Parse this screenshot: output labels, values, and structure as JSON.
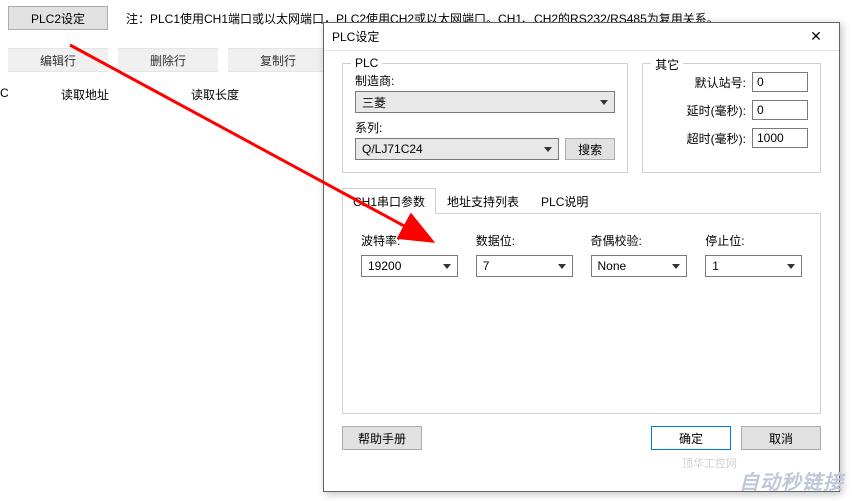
{
  "top": {
    "plc2_btn": "PLC2设定",
    "note": "注：PLC1使用CH1端口或以太网端口，PLC2使用CH2或以太网端口。CH1、CH2的RS232/RS485为复用关系。"
  },
  "buttons": {
    "edit": "编辑行",
    "delete": "删除行",
    "copy": "复制行"
  },
  "cols": {
    "c": "C",
    "addr": "读取地址",
    "len": "读取长度"
  },
  "dialog": {
    "title": "PLC设定",
    "plc_legend": "PLC",
    "other_legend": "其它",
    "maker_label": "制造商:",
    "maker_value": "三菱",
    "series_label": "系列:",
    "series_value": "Q/LJ71C24",
    "search": "搜索",
    "default_station": "默认站号:",
    "default_station_val": "0",
    "delay": "延时(毫秒):",
    "delay_val": "0",
    "timeout": "超时(毫秒):",
    "timeout_val": "1000",
    "tabs": {
      "serial": "CH1串口参数",
      "addr": "地址支持列表",
      "plc": "PLC说明"
    },
    "baud_label": "波特率:",
    "baud_value": "19200",
    "databit_label": "数据位:",
    "databit_value": "7",
    "parity_label": "奇偶校验:",
    "parity_value": "None",
    "stopbit_label": "停止位:",
    "stopbit_value": "1",
    "help": "帮助手册",
    "ok": "确定",
    "cancel": "取消"
  },
  "watermark": "自动秒链接"
}
